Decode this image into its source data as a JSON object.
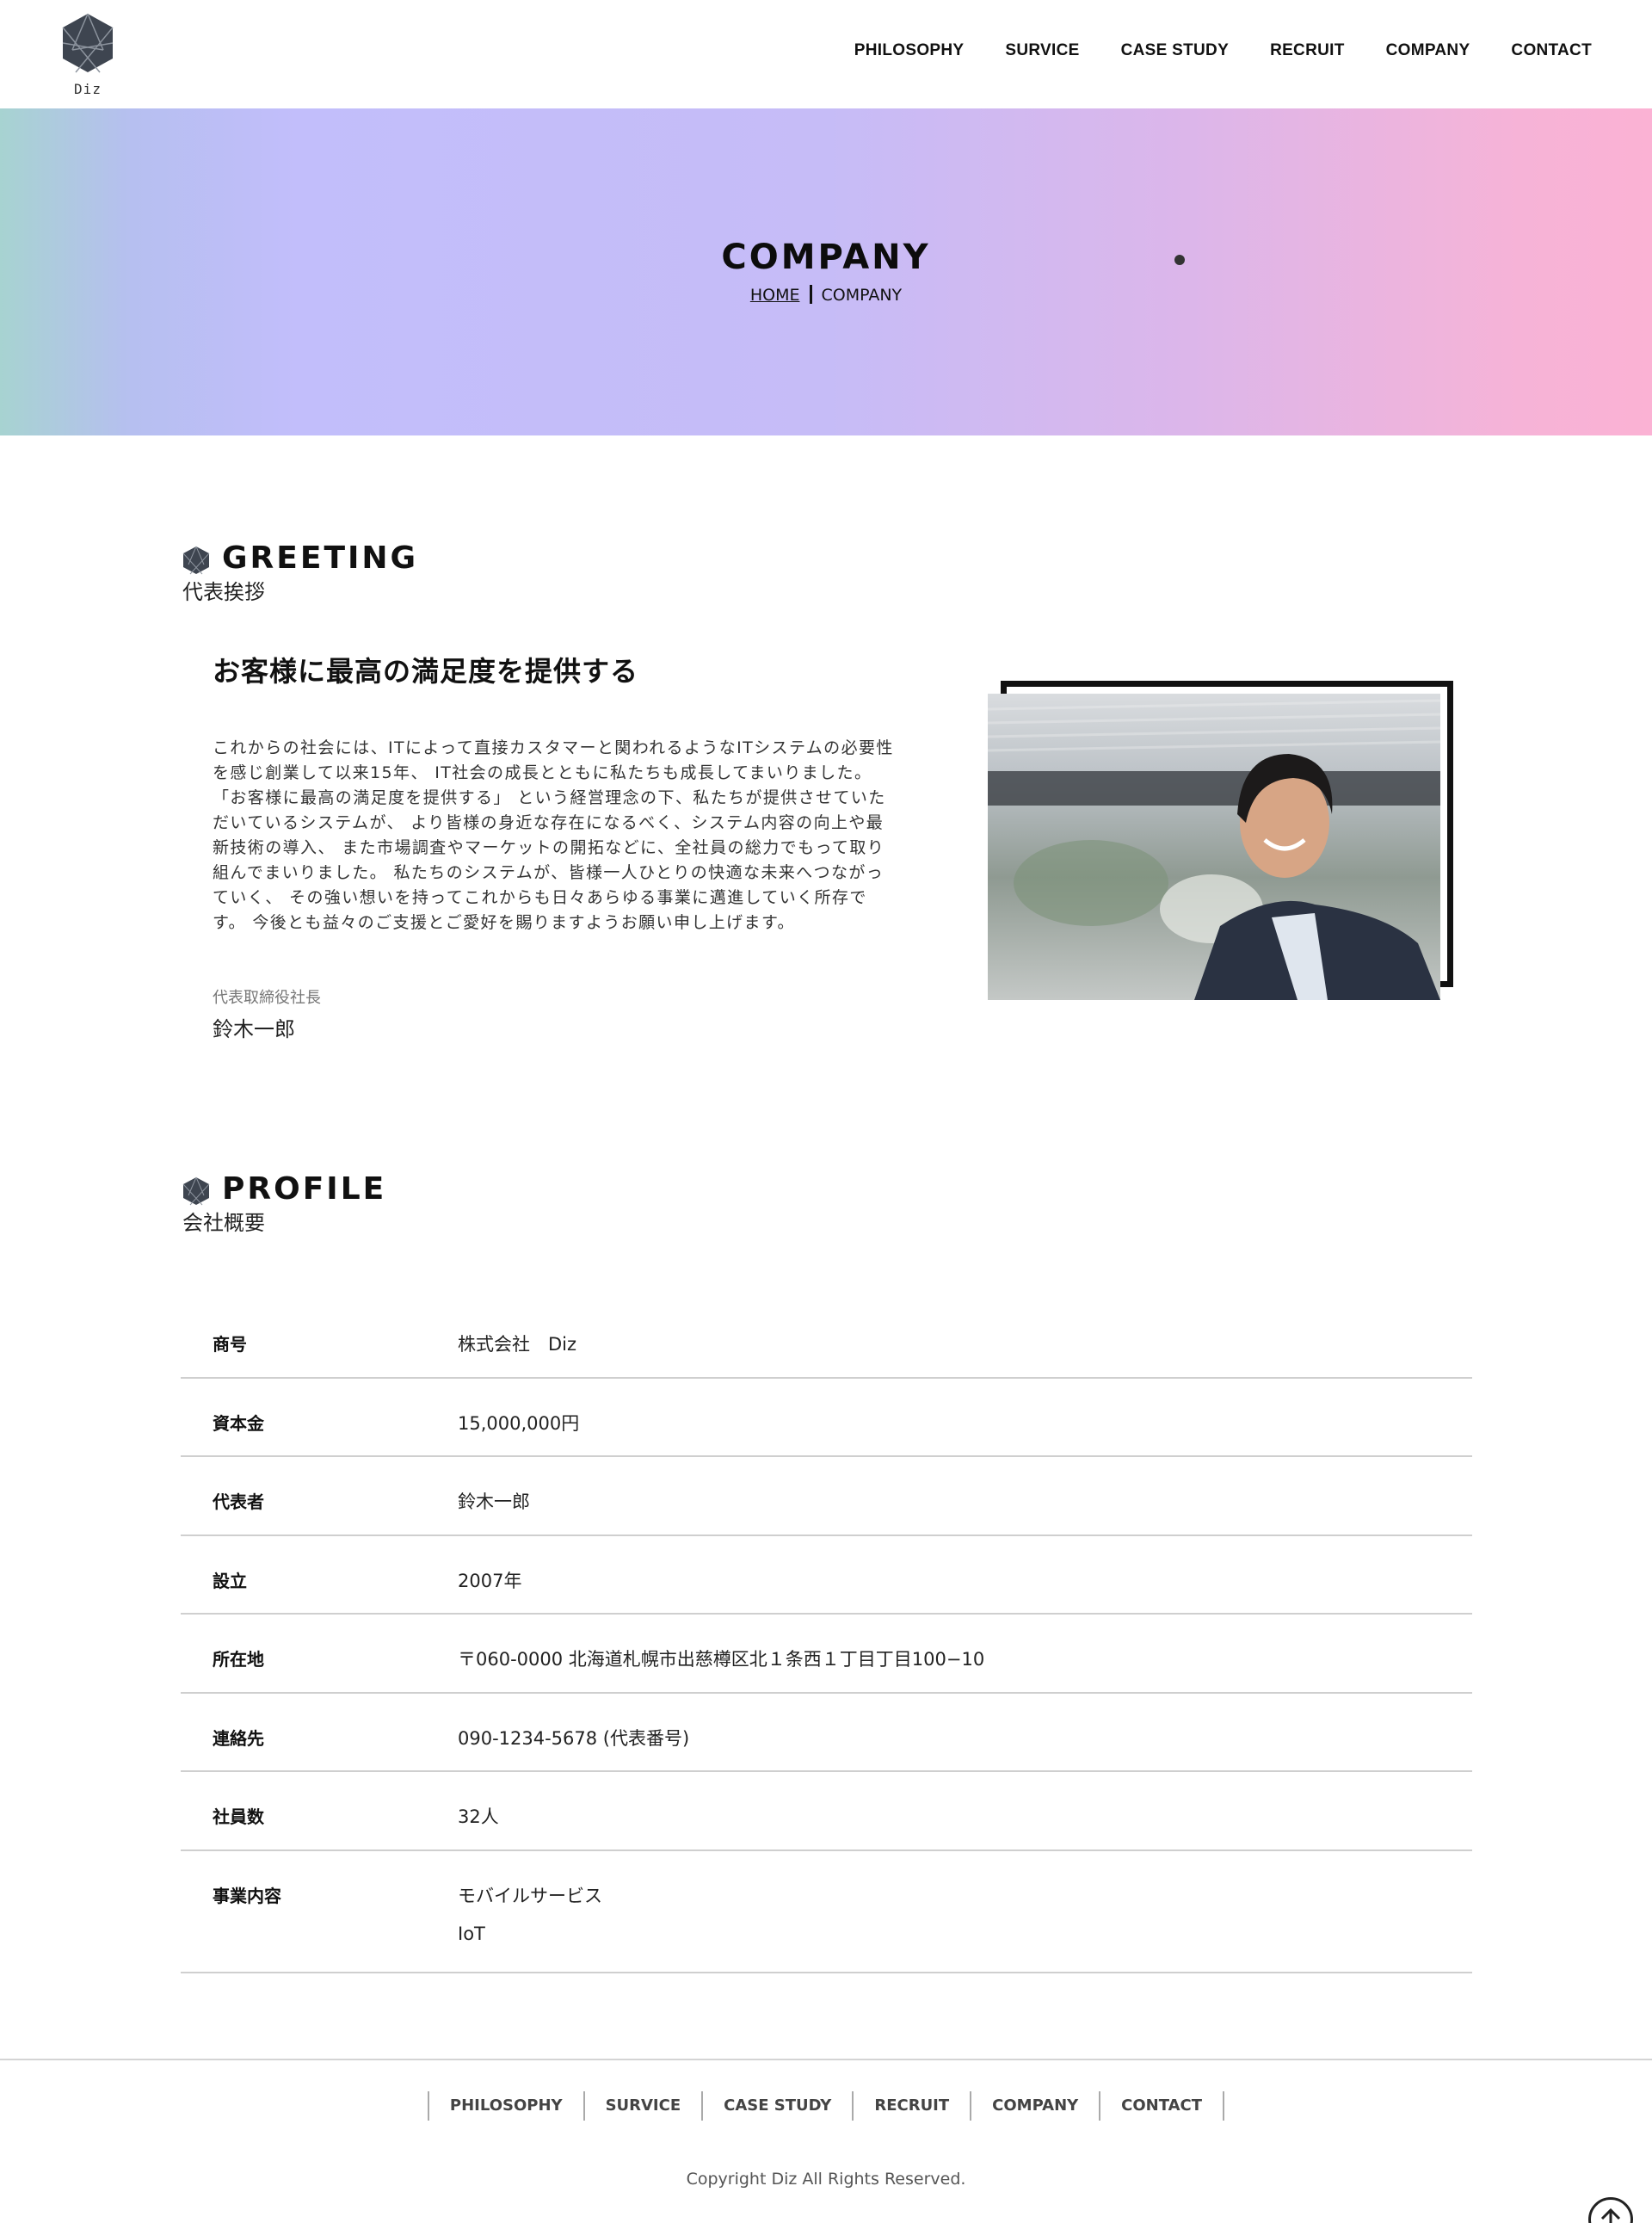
{
  "header": {
    "logo_text": "Diz",
    "nav": [
      "PHILOSOPHY",
      "SURVICE",
      "CASE STUDY",
      "RECRUIT",
      "COMPANY",
      "CONTACT"
    ]
  },
  "hero": {
    "title": "COMPANY",
    "breadcrumb": {
      "home": "HOME",
      "current": "COMPANY"
    }
  },
  "greeting": {
    "heading_en": "GREETING",
    "heading_jp": "代表挨拶",
    "title": "お客様に最高の満足度を提供する",
    "body_lines": [
      "これからの社会には、ITによって直接カスタマーと関われるようなITシステムの必要性",
      "を感じ創業して以来15年、 IT社会の成長とともに私たちも成長してまいりました。",
      "「お客様に最高の満足度を提供する」 という経営理念の下、私たちが提供させていた",
      "だいているシステムが、 より皆様の身近な存在になるべく、システム内容の向上や最",
      "新技術の導入、 また市場調査やマーケットの開拓などに、全社員の総力でもって取り",
      "組んでまいりました。 私たちのシステムが、皆様一人ひとりの快適な未来へつながっ",
      "ていく、 その強い想いを持ってこれからも日々あらゆる事業に邁進していく所存で",
      "す。 今後とも益々のご支援とご愛好を賜りますようお願い申し上げます。"
    ],
    "ceo_title": "代表取締役社長",
    "ceo_name": "鈴木一郎"
  },
  "profile": {
    "heading_en": "PROFILE",
    "heading_jp": "会社概要",
    "rows": [
      {
        "label": "商号",
        "value": "株式会社　Diz"
      },
      {
        "label": "資本金",
        "value": "15,000,000円"
      },
      {
        "label": "代表者",
        "value": "鈴木一郎"
      },
      {
        "label": "設立",
        "value": "2007年"
      },
      {
        "label": "所在地",
        "value": "〒060-0000 北海道札幌市出慈樽区北１条西１丁目丁目100−10"
      },
      {
        "label": "連絡先",
        "value": "090-1234-5678 (代表番号)"
      },
      {
        "label": "社員数",
        "value": "32人"
      },
      {
        "label": "事業内容",
        "values": [
          "モバイルサービス",
          "IoT"
        ]
      }
    ]
  },
  "footer": {
    "nav": [
      "PHILOSOPHY",
      "SURVICE",
      "CASE STUDY",
      "RECRUIT",
      "COMPANY",
      "CONTACT"
    ],
    "copyright": "Copyright Diz All Rights Reserved."
  },
  "icons": {
    "logo": "hexagon-logo-icon",
    "section_marker": "hexagon-icon",
    "back_to_top": "arrow-up-circle-icon"
  },
  "colors": {
    "hero_gradient": [
      "#a7d3d1",
      "#c2befb",
      "#fbb2d4"
    ],
    "text": "#111111",
    "rule": "#cfcfcf"
  }
}
